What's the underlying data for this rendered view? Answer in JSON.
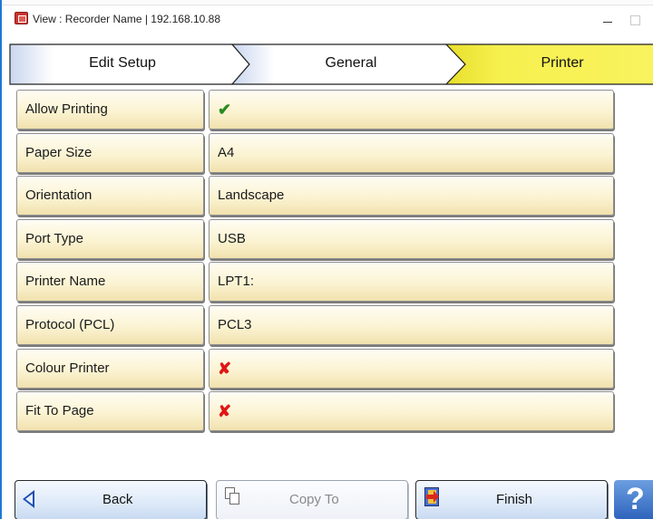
{
  "window": {
    "title": "View : Recorder Name | 192.168.10.88"
  },
  "crumbs": [
    {
      "label": "Edit Setup"
    },
    {
      "label": "General"
    },
    {
      "label": "Printer"
    }
  ],
  "settings": [
    {
      "label": "Allow Printing",
      "value": "✔",
      "kind": "check"
    },
    {
      "label": "Paper Size",
      "value": "A4",
      "kind": "text"
    },
    {
      "label": "Orientation",
      "value": "Landscape",
      "kind": "text"
    },
    {
      "label": "Port Type",
      "value": "USB",
      "kind": "text"
    },
    {
      "label": "Printer Name",
      "value": "LPT1:",
      "kind": "text"
    },
    {
      "label": "Protocol (PCL)",
      "value": "PCL3",
      "kind": "text"
    },
    {
      "label": "Colour Printer",
      "value": "✘",
      "kind": "cross"
    },
    {
      "label": "Fit To Page",
      "value": "✘",
      "kind": "cross"
    }
  ],
  "buttons": {
    "back": "Back",
    "copy_to": "Copy To",
    "finish": "Finish",
    "help": "?"
  },
  "colors": {
    "active_tab": "#f4ee4a",
    "cell": "#fbf3d2",
    "check": "#2b8a1f",
    "cross": "#e01616"
  }
}
